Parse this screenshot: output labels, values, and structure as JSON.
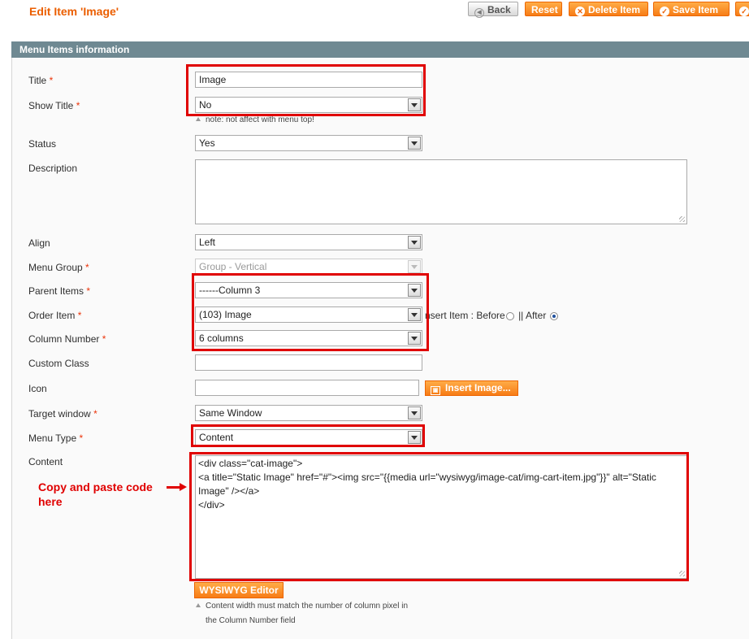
{
  "page": {
    "title": "Edit Item 'Image'",
    "accent_color": "#eb5e00",
    "highlight_color": "#e00000"
  },
  "toolbar": {
    "back_label": "Back",
    "reset_label": "Reset",
    "delete_label": "Delete Item",
    "save_label": "Save Item",
    "back_icon": "chevron-left-icon",
    "delete_icon": "delete-circle-icon",
    "save_icon": "check-circle-icon"
  },
  "section": {
    "title": "Menu Items information"
  },
  "form": {
    "title": {
      "label": "Title",
      "value": "Image"
    },
    "show_title": {
      "label": "Show Title",
      "value": "No",
      "note": "note: not affect with menu top!"
    },
    "status": {
      "label": "Status",
      "value": "Yes"
    },
    "description": {
      "label": "Description",
      "value": ""
    },
    "align": {
      "label": "Align",
      "value": "Left"
    },
    "menu_group": {
      "label": "Menu Group",
      "value": "Group - Vertical"
    },
    "parent_items": {
      "label": "Parent Items",
      "value": "------Column 3"
    },
    "order_item": {
      "label": "Order Item",
      "value": "(103) Image"
    },
    "insert_item": {
      "label": "nsert Item : Before",
      "separator": "|| After",
      "selected": "After"
    },
    "column_number": {
      "label": "Column Number",
      "value": "6 columns"
    },
    "custom_class": {
      "label": "Custom Class",
      "value": ""
    },
    "icon": {
      "label": "Icon",
      "value": "",
      "button_label": "Insert Image..."
    },
    "target_window": {
      "label": "Target window",
      "value": "Same Window"
    },
    "menu_type": {
      "label": "Menu Type",
      "value": "Content"
    },
    "content": {
      "label": "Content",
      "value": "<div class=\"cat-image\">\n<a title=\"Static Image\" href=\"#\"><img src=\"{{media url=\"wysiwyg/image-cat/img-cart-item.jpg\"}}\" alt=\"Static Image\" /></a>\n</div>",
      "editor_button": "WYSIWYG Editor",
      "note_line1": "Content width must match the number of column pixel in",
      "note_line2": "the Column Number field"
    }
  },
  "annotation": {
    "line1": "Copy and paste code",
    "line2": "here"
  }
}
